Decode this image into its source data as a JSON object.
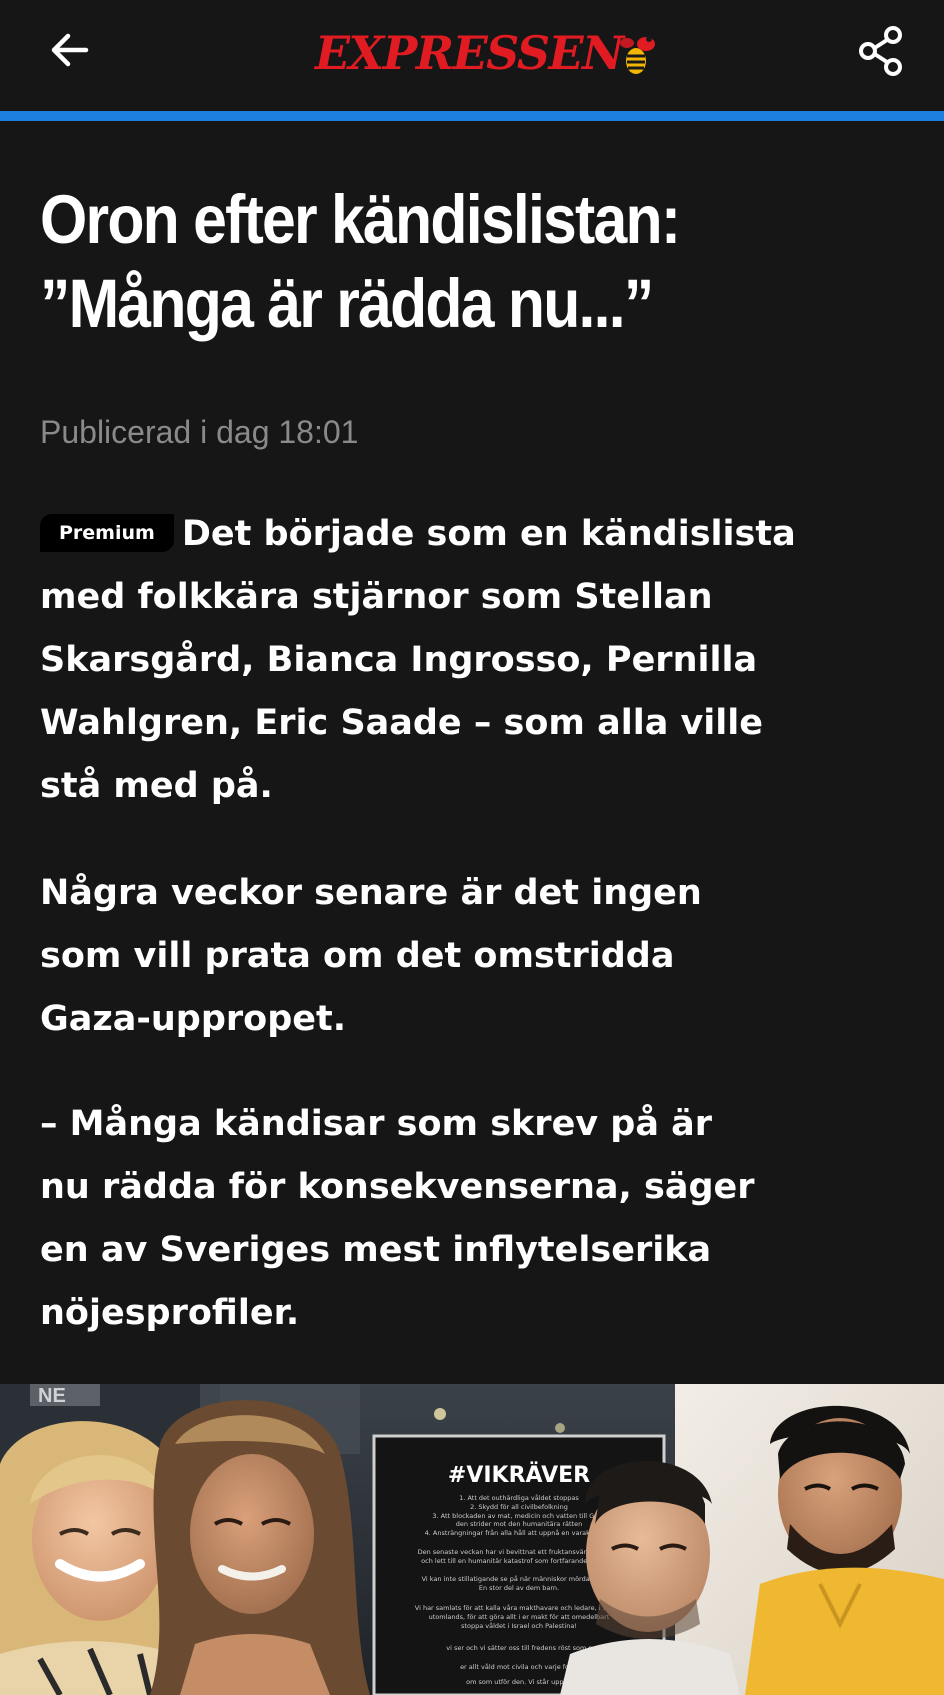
{
  "header": {
    "brand": "EXPRESSEN",
    "back_icon": "arrow-left-icon",
    "share_icon": "share-icon",
    "accent_color": "#1d7fe0",
    "brand_color": "#e01b22"
  },
  "article": {
    "headline_line1": "Oron efter kändislistan:",
    "headline_line2": "”Många är rädda nu...”",
    "published": "Publicerad i dag 18:01",
    "premium_badge": "Premium",
    "p1_line1": "Det började som en kändislista",
    "p1_line2": "med folkkära stjärnor som Stellan",
    "p1_line3": "Skarsgård, Bianca Ingrosso, Pernilla",
    "p1_line4": "Wahlgren, Eric Saade – som alla ville",
    "p1_line5": "stå med på.",
    "p2_line1": "Några veckor senare är det ingen",
    "p2_line2": "som vill prata om det omstridda",
    "p2_line3": "Gaza-uppropet.",
    "p3_line1": "– Många kändisar som skrev på är",
    "p3_line2": "nu rädda för konsekvenserna, säger",
    "p3_line3": "en av Sveriges mest inflytelserika",
    "p3_line4": "nöjesprofiler."
  },
  "photo": {
    "poster_title": "#VIKRÄVER",
    "poster_line1": "1. Att det outhärdliga våldet stoppas",
    "poster_line2": "2. Skydd för all civilbefolkning",
    "poster_line3": "3. Att blockaden av mat, medicin och vatten till Gaza",
    "poster_line4": "den strider mot den humanitära rätten",
    "poster_line5": "4. Ansträngningar från alla håll att uppnå en varaktig fred",
    "poster_line6": "Den senaste veckan har vi bevittnat ett fruktansvärt våld som",
    "poster_line7": "och lett till en humanitär katastrof som fortfarande pågår. O",
    "poster_line8": "Vi kan inte stillatigande se på när människor mördas och liv",
    "poster_line9": "En stor del av dem barn.",
    "poster_line10": "Vi har samlats för att kalla våra makthavare och ledare, i Sverig",
    "poster_line11": "utomlands, för att göra allt i er makt för att omedelbart",
    "poster_line12": "stoppa våldet i Israel och Palestina!",
    "poster_line13": "vi ser och vi sätter oss till fredens röst som s",
    "poster_line14": "er allt våld mot civila och varje form",
    "poster_line15": "om som utför den. Vi står upp m",
    "sign_text": "NE"
  }
}
